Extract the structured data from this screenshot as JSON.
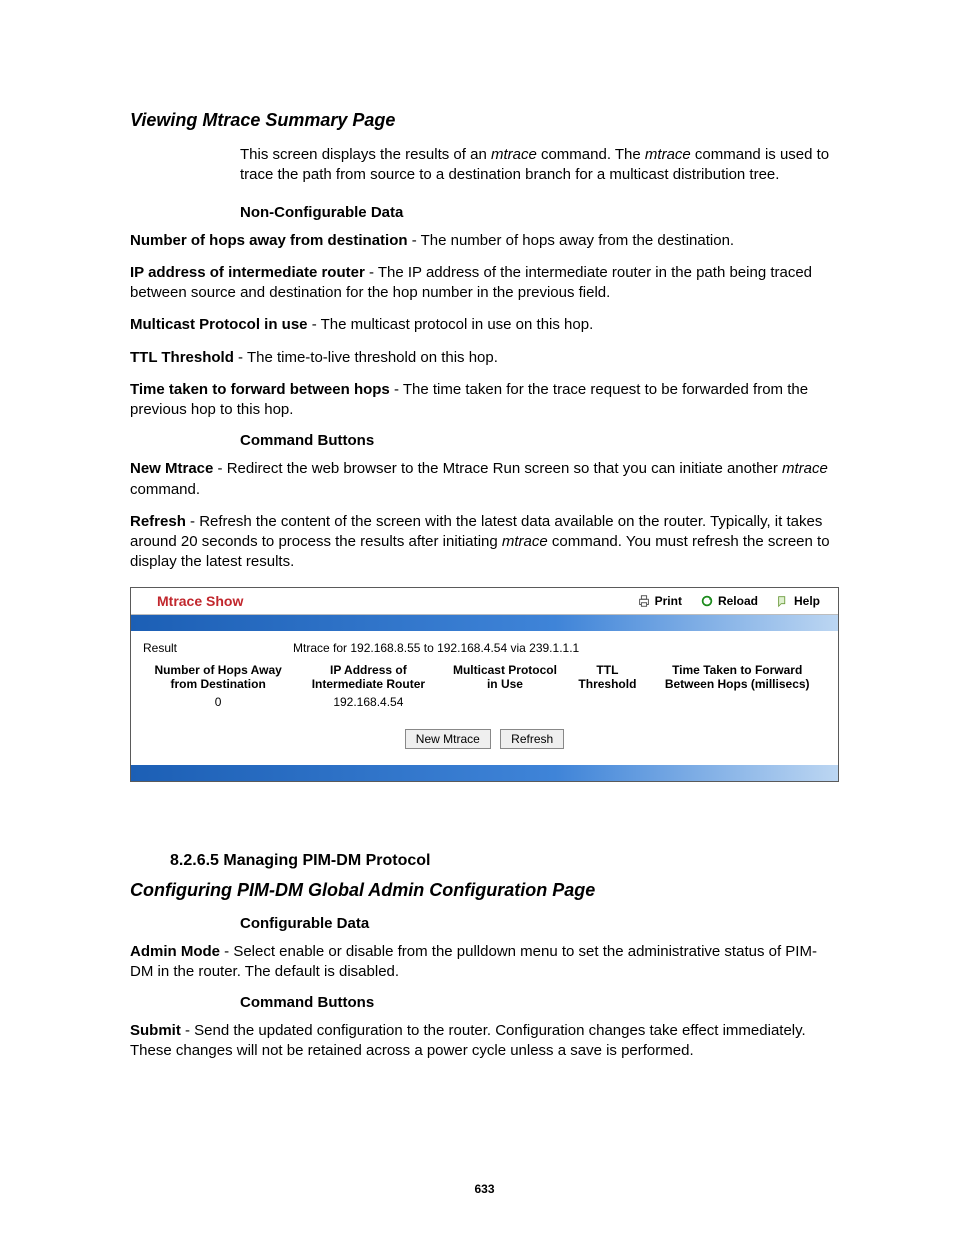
{
  "page_number": "633",
  "section1": {
    "title": "Viewing Mtrace Summary Page",
    "intro_html": "This screen displays the results of an <span class=\"em\">mtrace</span> command. The <span class=\"em\">mtrace</span> command is used to trace the path from source to a destination branch for a multicast distribution tree.",
    "non_conf_heading": "Non-Configurable Data",
    "fields": [
      {
        "label": "Number of hops away from destination",
        "text": " - The number of hops away from the destination."
      },
      {
        "label": "IP address of intermediate router",
        "text": " - The IP address of the intermediate router in the path being traced between source and destination for the hop number in the previous field."
      },
      {
        "label": "Multicast Protocol in use",
        "text": " - The multicast protocol in use on this hop."
      },
      {
        "label": "TTL Threshold",
        "text": " - The time-to-live threshold on this hop."
      },
      {
        "label": "Time taken to forward between hops",
        "text": " - The time taken for the trace request to be forwarded from the previous hop to this hop."
      }
    ],
    "cmd_heading": "Command Buttons",
    "cmds": [
      {
        "label": "New Mtrace",
        "text_html": " - Redirect the web browser to the Mtrace Run screen so that you can initiate another <span class=\"em\">mtrace</span> command."
      },
      {
        "label": "Refresh",
        "text_html": " - Refresh the content of the screen with the latest data available on the router. Typically, it takes around 20 seconds to process the results after initiating <span class=\"em\">mtrace</span> command. You must refresh the screen to display the latest results."
      }
    ]
  },
  "screenshot": {
    "title": "Mtrace Show",
    "tools": {
      "print": "Print",
      "reload": "Reload",
      "help": "Help"
    },
    "result_label": "Result",
    "result_value": "Mtrace for 192.168.8.55 to 192.168.4.54 via 239.1.1.1",
    "headers": [
      "Number of Hops Away from Destination",
      "IP Address of Intermediate Router",
      "Multicast Protocol in Use",
      "TTL Threshold",
      "Time Taken to Forward Between Hops (millisecs)"
    ],
    "rows": [
      {
        "hops": "0",
        "ip": "192.168.4.54",
        "proto": "",
        "ttl": "",
        "time": ""
      }
    ],
    "btn_new": "New Mtrace",
    "btn_refresh": "Refresh"
  },
  "section2": {
    "num_heading": "8.2.6.5 Managing PIM-DM Protocol",
    "title": "Configuring PIM-DM Global Admin Configuration Page",
    "conf_heading": "Configurable Data",
    "fields": [
      {
        "label": "Admin Mode",
        "text": " - Select enable or disable from the pulldown menu to set the administrative status of PIM-DM in the router. The default is disabled."
      }
    ],
    "cmd_heading": "Command Buttons",
    "cmds": [
      {
        "label": "Submit",
        "text": " - Send the updated configuration to the router. Configuration changes take effect immediately. These changes will not be retained across a power cycle unless a save is performed."
      }
    ]
  }
}
